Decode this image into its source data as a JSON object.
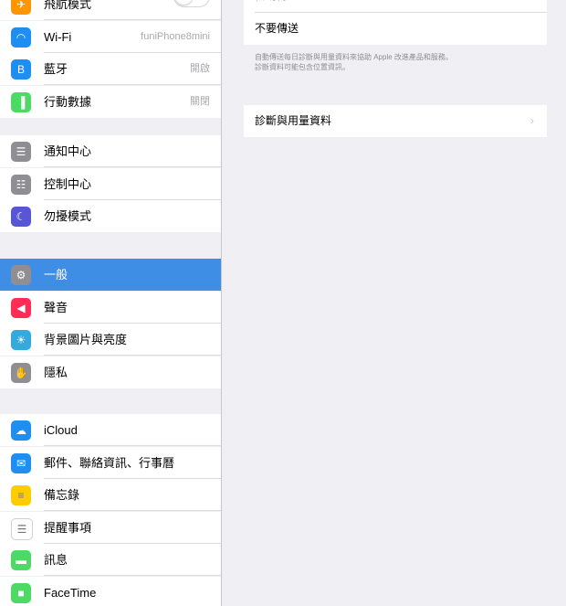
{
  "sidebar": {
    "groups": [
      [
        {
          "label": "飛航模式",
          "icon": "airplane-icon",
          "color": "#ff9500",
          "toggle": true
        },
        {
          "label": "Wi-Fi",
          "value": "funiPhone8mini",
          "icon": "wifi-icon",
          "color": "#1f8ef1"
        },
        {
          "label": "藍牙",
          "value": "開啟",
          "icon": "bluetooth-icon",
          "color": "#1f8ef1"
        },
        {
          "label": "行動數據",
          "value": "關閉",
          "icon": "cellular-icon",
          "color": "#4cd964"
        }
      ],
      [
        {
          "label": "通知中心",
          "icon": "notification-center-icon",
          "color": "#8e8e93"
        },
        {
          "label": "控制中心",
          "icon": "control-center-icon",
          "color": "#8e8e93"
        },
        {
          "label": "勿擾模式",
          "icon": "moon-icon",
          "color": "#5856d6"
        }
      ],
      [
        {
          "label": "一般",
          "icon": "gear-icon",
          "color": "#8e8e93",
          "selected": true
        },
        {
          "label": "聲音",
          "icon": "speaker-icon",
          "color": "#ff2d55"
        },
        {
          "label": "背景圖片與亮度",
          "icon": "wallpaper-icon",
          "color": "#34aadc"
        },
        {
          "label": "隱私",
          "icon": "hand-icon",
          "color": "#8e8e93"
        }
      ],
      [
        {
          "label": "iCloud",
          "icon": "cloud-icon",
          "color": "#1f8ef1"
        },
        {
          "label": "郵件、聯絡資訊、行事曆",
          "icon": "mail-icon",
          "color": "#1f8ef1"
        },
        {
          "label": "備忘錄",
          "icon": "notes-icon",
          "color": "#ffcc00"
        },
        {
          "label": "提醒事項",
          "icon": "reminders-icon",
          "color": "#ffffff"
        },
        {
          "label": "訊息",
          "icon": "messages-icon",
          "color": "#4cd964"
        },
        {
          "label": "FaceTime",
          "icon": "facetime-icon",
          "color": "#4cd964"
        }
      ]
    ]
  },
  "detail": {
    "options": [
      "自動傳送",
      "不要傳送"
    ],
    "footnote": "自動傳送每日診斷與用量資料來協助 Apple 改進產品和服務。診斷資料可能包含位置資訊。",
    "diagnostics_label": "診斷與用量資料"
  }
}
